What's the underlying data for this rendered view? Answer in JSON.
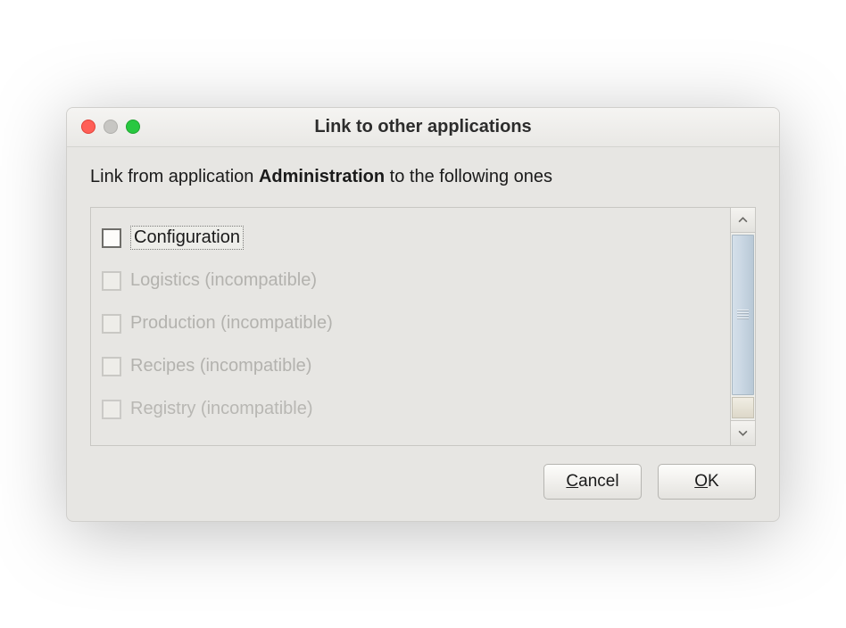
{
  "window": {
    "title": "Link to other applications"
  },
  "prompt": {
    "prefix": "Link from application ",
    "app_name": "Administration",
    "suffix": " to the following ones"
  },
  "items": [
    {
      "label": "Configuration",
      "enabled": true,
      "checked": false,
      "focused": true
    },
    {
      "label": "Logistics (incompatible)",
      "enabled": false,
      "checked": false,
      "focused": false
    },
    {
      "label": "Production (incompatible)",
      "enabled": false,
      "checked": false,
      "focused": false
    },
    {
      "label": "Recipes (incompatible)",
      "enabled": false,
      "checked": false,
      "focused": false
    },
    {
      "label": "Registry (incompatible)",
      "enabled": false,
      "checked": false,
      "focused": false
    }
  ],
  "buttons": {
    "cancel_pre": "C",
    "cancel_u": "",
    "cancel": "ancel",
    "ok_pre": "O",
    "ok_u": "",
    "ok": "K"
  }
}
